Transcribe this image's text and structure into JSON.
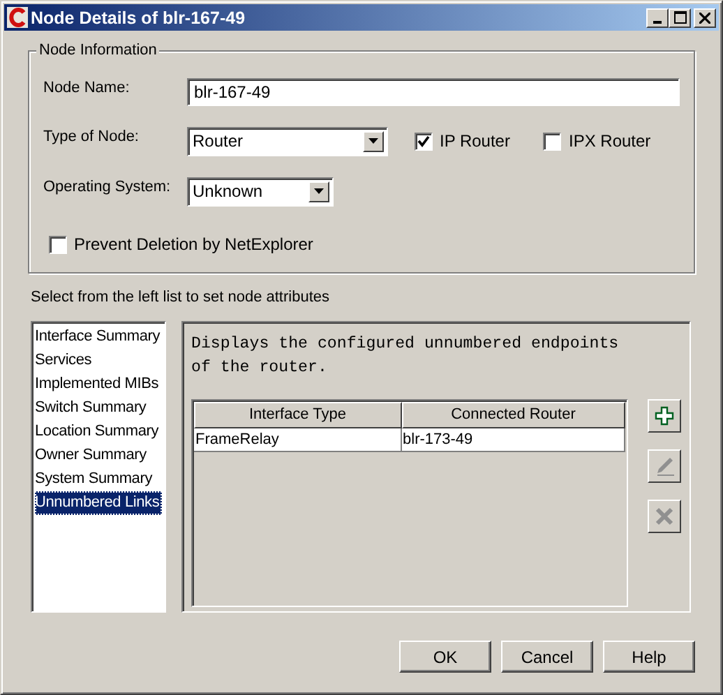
{
  "window": {
    "title": "Node Details of blr-167-49"
  },
  "node_information": {
    "title": "Node Information",
    "node_name": {
      "label": "Node Name:",
      "value": "blr-167-49"
    },
    "type_of_node": {
      "label": "Type of Node:",
      "value": "Router"
    },
    "router_options": [
      {
        "label": "IP Router",
        "checked": true
      },
      {
        "label": "IPX Router",
        "checked": false
      }
    ],
    "operating_system": {
      "label": "Operating System:",
      "value": "Unknown"
    },
    "prevent_deletion": {
      "label": "Prevent Deletion by NetExplorer",
      "checked": false
    }
  },
  "instruction": "Select from the left list to set node attributes",
  "attribute_list": [
    {
      "label": "Interface Summary",
      "selected": false
    },
    {
      "label": "Services",
      "selected": false
    },
    {
      "label": "Implemented MIBs",
      "selected": false
    },
    {
      "label": "Switch Summary",
      "selected": false
    },
    {
      "label": "Location Summary",
      "selected": false
    },
    {
      "label": "Owner Summary",
      "selected": false
    },
    {
      "label": "System Summary",
      "selected": false
    },
    {
      "label": "Unnumbered Links",
      "selected": true
    }
  ],
  "detail_panel": {
    "description": "Displays the configured unnumbered endpoints of the router.",
    "table": {
      "columns": [
        "Interface Type",
        "Connected Router"
      ],
      "rows": [
        [
          "FrameRelay",
          "blr-173-49"
        ]
      ]
    },
    "side_buttons": [
      {
        "kind": "add",
        "disabled": false
      },
      {
        "kind": "edit",
        "disabled": true
      },
      {
        "kind": "delete",
        "disabled": true
      }
    ]
  },
  "buttons": [
    "OK",
    "Cancel",
    "Help"
  ]
}
